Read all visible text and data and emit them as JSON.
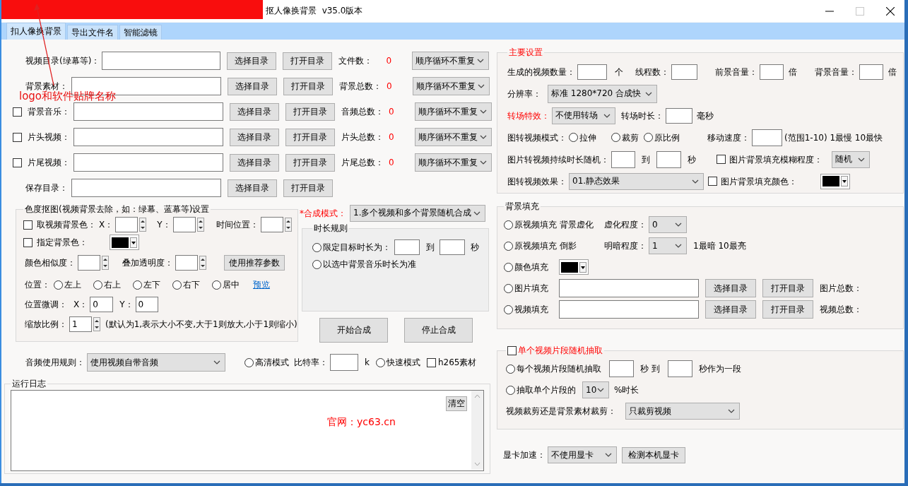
{
  "window": {
    "title": "抠人像换背景  v35.0版本"
  },
  "annotation": {
    "text": "logo和软件贴牌名称"
  },
  "tabs": [
    {
      "label": "扣人像换背景",
      "selected": true
    },
    {
      "label": "导出文件名",
      "selected": false
    },
    {
      "label": "智能滤镜",
      "selected": false
    }
  ],
  "source_rows": [
    {
      "items": [
        {
          "kind": "label",
          "text": "视频目录(绿幕等)："
        },
        {
          "kind": "input"
        },
        {
          "kind": "button",
          "label": "选择目录"
        },
        {
          "kind": "button",
          "label": "打开目录"
        },
        {
          "kind": "label",
          "text": "文件数："
        },
        {
          "kind": "count",
          "text": "0"
        },
        {
          "kind": "select",
          "value": "顺序循环不重复"
        }
      ]
    },
    {
      "items": [
        {
          "kind": "label",
          "text": "背景素材："
        },
        {
          "kind": "input"
        },
        {
          "kind": "button",
          "label": "选择目录"
        },
        {
          "kind": "button",
          "label": "打开目录"
        },
        {
          "kind": "label",
          "text": "背景总数："
        },
        {
          "kind": "count",
          "text": "0"
        },
        {
          "kind": "select",
          "value": "顺序循环不重复"
        }
      ]
    },
    {
      "items": [
        {
          "kind": "checkbox",
          "label": "背景音乐：",
          "checked": false
        },
        {
          "kind": "input"
        },
        {
          "kind": "button",
          "label": "选择目录"
        },
        {
          "kind": "button",
          "label": "打开目录"
        },
        {
          "kind": "label",
          "text": "音频总数："
        },
        {
          "kind": "count",
          "text": "0"
        },
        {
          "kind": "select",
          "value": "顺序循环不重复"
        }
      ]
    },
    {
      "items": [
        {
          "kind": "checkbox",
          "label": "片头视频：",
          "checked": false
        },
        {
          "kind": "input"
        },
        {
          "kind": "button",
          "label": "选择目录"
        },
        {
          "kind": "button",
          "label": "打开目录"
        },
        {
          "kind": "label",
          "text": "片头总数："
        },
        {
          "kind": "count",
          "text": "0"
        },
        {
          "kind": "select",
          "value": "顺序循环不重复"
        }
      ]
    },
    {
      "items": [
        {
          "kind": "checkbox",
          "label": "片尾视频：",
          "checked": false
        },
        {
          "kind": "input"
        },
        {
          "kind": "button",
          "label": "选择目录"
        },
        {
          "kind": "button",
          "label": "打开目录"
        },
        {
          "kind": "label",
          "text": "片尾总数："
        },
        {
          "kind": "count",
          "text": "0"
        },
        {
          "kind": "select",
          "value": "顺序循环不重复"
        }
      ]
    },
    {
      "items": [
        {
          "kind": "label",
          "text": "保存目录："
        },
        {
          "kind": "input"
        },
        {
          "kind": "button",
          "label": "选择目录"
        },
        {
          "kind": "button",
          "label": "打开目录"
        }
      ]
    }
  ],
  "chroma_key": {
    "title": "色度抠图(视频背景去除，如：绿幕、蓝幕等)设置",
    "accent": false,
    "rows": [
      {
        "items": [
          {
            "kind": "checkbox",
            "label": "取视频背景色：",
            "checked": false
          },
          {
            "kind": "label",
            "text": "X："
          },
          {
            "kind": "spin"
          },
          {
            "kind": "label",
            "text": "Y："
          },
          {
            "kind": "spin"
          },
          {
            "kind": "label",
            "text": "时间位置："
          },
          {
            "kind": "spin"
          }
        ]
      },
      {
        "items": [
          {
            "kind": "checkbox",
            "label": "指定背景色：",
            "checked": false
          },
          {
            "kind": "color",
            "color": "#000000"
          }
        ]
      },
      {
        "items": [
          {
            "kind": "label",
            "text": "颜色相似度："
          },
          {
            "kind": "spin"
          },
          {
            "kind": "label",
            "text": "叠加透明度："
          },
          {
            "kind": "spin"
          },
          {
            "kind": "button",
            "label": "使用推荐参数"
          }
        ]
      },
      {
        "items": [
          {
            "kind": "label",
            "text": "位置："
          },
          {
            "kind": "radio",
            "label": "左上",
            "selected": false
          },
          {
            "kind": "radio",
            "label": "右上",
            "selected": false
          },
          {
            "kind": "radio",
            "label": "左下",
            "selected": false
          },
          {
            "kind": "radio",
            "label": "右下",
            "selected": false
          },
          {
            "kind": "radio",
            "label": "居中",
            "selected": false
          },
          {
            "kind": "link",
            "text": "预览"
          }
        ]
      },
      {
        "items": [
          {
            "kind": "label",
            "text": "位置微调："
          },
          {
            "kind": "label",
            "text": "X："
          },
          {
            "kind": "input",
            "value": "0"
          },
          {
            "kind": "label",
            "text": "Y："
          },
          {
            "kind": "input",
            "value": "0"
          }
        ]
      },
      {
        "items": [
          {
            "kind": "label",
            "text": "缩放比例："
          },
          {
            "kind": "spin",
            "value": "1"
          },
          {
            "kind": "label",
            "text": "(默认为1,表示大小不变,大于1则放大,小于1则缩小)"
          }
        ]
      }
    ]
  },
  "compose_mode": [
    {
      "kind": "warn-label",
      "text": "*合成模式："
    },
    {
      "kind": "select",
      "value": "1.多个视频和多个背景随机合成"
    }
  ],
  "duration_rule": {
    "title": "时长规则",
    "accent": false,
    "rows": [
      {
        "items": [
          {
            "kind": "radio",
            "label": "限定目标时长为：",
            "selected": false
          },
          {
            "kind": "input"
          },
          {
            "kind": "label",
            "text": "到"
          },
          {
            "kind": "input"
          },
          {
            "kind": "label",
            "text": "秒"
          }
        ]
      },
      {
        "items": [
          {
            "kind": "radio",
            "label": "以选中背景音乐时长为准",
            "selected": false
          }
        ]
      }
    ]
  },
  "actions": [
    {
      "label": "开始合成"
    },
    {
      "label": "停止合成"
    }
  ],
  "audio_row": [
    {
      "kind": "label",
      "text": "音频使用规则："
    },
    {
      "kind": "select",
      "value": "使用视频自带音频"
    },
    {
      "kind": "radio",
      "label": "高清模式",
      "selected": false
    },
    {
      "kind": "label",
      "text": "比特率："
    },
    {
      "kind": "input"
    },
    {
      "kind": "label",
      "text": "k"
    },
    {
      "kind": "radio",
      "label": "快速模式",
      "selected": false
    },
    {
      "kind": "checkbox",
      "label": "h265素材",
      "checked": false
    }
  ],
  "log": {
    "title": "运行日志",
    "clear_button": "清空",
    "notice": "官网：yc63.cn"
  },
  "main_settings": {
    "title": "主要设置",
    "accent": true,
    "rows": [
      {
        "items": [
          {
            "kind": "label",
            "text": "生成的视频数量："
          },
          {
            "kind": "input"
          },
          {
            "kind": "label",
            "text": "个"
          },
          {
            "kind": "label",
            "text": "线程数："
          },
          {
            "kind": "input"
          },
          {
            "kind": "label",
            "text": "前景音量："
          },
          {
            "kind": "input"
          },
          {
            "kind": "label",
            "text": "倍"
          },
          {
            "kind": "label",
            "text": "背景音量："
          },
          {
            "kind": "input"
          },
          {
            "kind": "label",
            "text": "倍"
          }
        ]
      },
      {
        "items": [
          {
            "kind": "label",
            "text": "分辨率："
          },
          {
            "kind": "select",
            "value": "标准 1280*720 合成快"
          }
        ]
      },
      {
        "items": [
          {
            "kind": "warn-label",
            "text": "转场特效："
          },
          {
            "kind": "select",
            "value": "不使用转场"
          },
          {
            "kind": "label",
            "text": "转场时长："
          },
          {
            "kind": "input"
          },
          {
            "kind": "label",
            "text": "毫秒"
          }
        ]
      },
      {
        "items": [
          {
            "kind": "label",
            "text": "图转视频模式："
          },
          {
            "kind": "radio",
            "label": "拉伸",
            "selected": false
          },
          {
            "kind": "radio",
            "label": "裁剪",
            "selected": false
          },
          {
            "kind": "radio",
            "label": "原比例",
            "selected": false
          },
          {
            "kind": "label",
            "text": "移动速度："
          },
          {
            "kind": "input"
          },
          {
            "kind": "label",
            "text": "(范围1-10)  1最慢 10最快"
          }
        ]
      },
      {
        "items": [
          {
            "kind": "label",
            "text": "图片转视频持续时长随机："
          },
          {
            "kind": "input"
          },
          {
            "kind": "label",
            "text": "到"
          },
          {
            "kind": "input"
          },
          {
            "kind": "label",
            "text": "秒"
          },
          {
            "kind": "checkbox",
            "label": "图片背景填充模糊程度：",
            "checked": false
          },
          {
            "kind": "select",
            "value": "随机"
          }
        ]
      },
      {
        "items": [
          {
            "kind": "label",
            "text": "图转视频效果："
          },
          {
            "kind": "select",
            "value": "01.静态效果"
          },
          {
            "kind": "checkbox",
            "label": "图片背景填充颜色：",
            "checked": false
          },
          {
            "kind": "color",
            "color": "#000000"
          }
        ]
      }
    ]
  },
  "background_fill": {
    "title": "背景填充",
    "accent": false,
    "rows": [
      {
        "items": [
          {
            "kind": "radio",
            "label": "原视频填充 背景虚化",
            "selected": false
          },
          {
            "kind": "label",
            "text": "虚化程度："
          },
          {
            "kind": "select",
            "value": "0"
          }
        ]
      },
      {
        "items": [
          {
            "kind": "radio",
            "label": "原视频填充 倒影",
            "selected": false
          },
          {
            "kind": "label",
            "text": "明暗程度："
          },
          {
            "kind": "select",
            "value": "1"
          },
          {
            "kind": "label",
            "text": "1最暗 10最亮"
          }
        ]
      },
      {
        "items": [
          {
            "kind": "radio",
            "label": "颜色填充",
            "selected": false
          },
          {
            "kind": "color",
            "color": "#000000"
          }
        ]
      },
      {
        "items": [
          {
            "kind": "radio",
            "label": "图片填充",
            "selected": false
          },
          {
            "kind": "input"
          },
          {
            "kind": "button",
            "label": "选择目录"
          },
          {
            "kind": "button",
            "label": "打开目录"
          },
          {
            "kind": "label",
            "text": "图片总数："
          }
        ]
      },
      {
        "items": [
          {
            "kind": "radio",
            "label": "视频填充",
            "selected": false
          },
          {
            "kind": "input"
          },
          {
            "kind": "button",
            "label": "选择目录"
          },
          {
            "kind": "button",
            "label": "打开目录"
          },
          {
            "kind": "label",
            "text": "视频总数："
          }
        ]
      }
    ]
  },
  "random_clip": {
    "title": "单个视频片段随机抽取",
    "checked": false,
    "rows": [
      {
        "items": [
          {
            "kind": "radio",
            "label": "每个视频片段随机抽取",
            "selected": false
          },
          {
            "kind": "input"
          },
          {
            "kind": "label",
            "text": "秒 到"
          },
          {
            "kind": "input"
          },
          {
            "kind": "label",
            "text": "秒作为一段"
          }
        ]
      },
      {
        "items": [
          {
            "kind": "radio",
            "label": "抽取单个片段的",
            "selected": false
          },
          {
            "kind": "select",
            "value": "10"
          },
          {
            "kind": "label",
            "text": "%时长"
          }
        ]
      },
      {
        "items": [
          {
            "kind": "label",
            "text": "视频裁剪还是背景素材裁剪："
          },
          {
            "kind": "select",
            "value": "只裁剪视频"
          }
        ]
      }
    ]
  },
  "gpu_row": [
    {
      "kind": "label",
      "text": "显卡加速："
    },
    {
      "kind": "select",
      "value": "不使用显卡"
    },
    {
      "kind": "button",
      "label": "检测本机显卡"
    }
  ]
}
